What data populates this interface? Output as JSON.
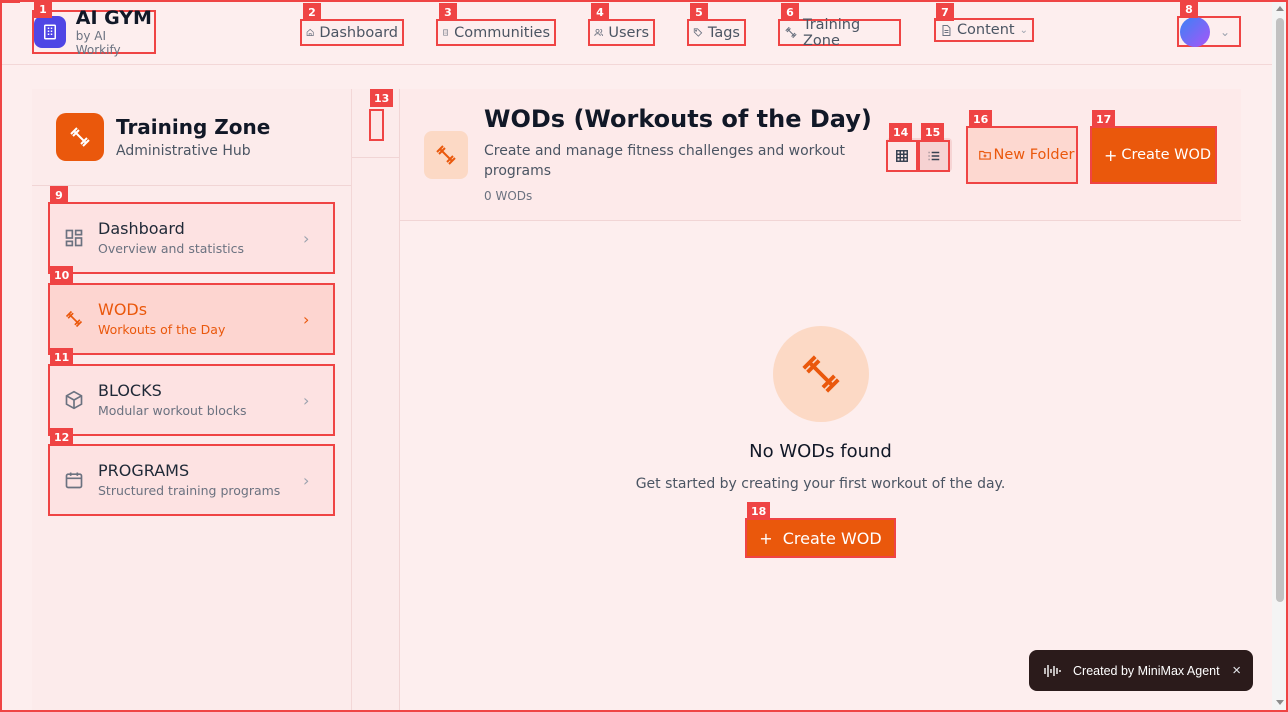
{
  "colors": {
    "accent": "#ea580c",
    "brand": "#4f46e5",
    "annotation": "#ef4444",
    "background": "#fdeeee"
  },
  "brand": {
    "title": "AI GYM",
    "subtitle": "by AI Workify",
    "icon": "building-icon"
  },
  "nav": {
    "items": [
      {
        "label": "Dashboard",
        "icon": "home-icon"
      },
      {
        "label": "Communities",
        "icon": "building-icon"
      },
      {
        "label": "Users",
        "icon": "users-icon"
      },
      {
        "label": "Tags",
        "icon": "tag-icon"
      },
      {
        "label": "Training Zone",
        "icon": "dumbbell-icon"
      },
      {
        "label": "Content",
        "icon": "document-icon"
      }
    ]
  },
  "badges": [
    "1",
    "2",
    "3",
    "4",
    "5",
    "6",
    "7",
    "8",
    "9",
    "10",
    "11",
    "12",
    "13",
    "14",
    "15",
    "16",
    "17",
    "18"
  ],
  "sidebar": {
    "title": "Training Zone",
    "subtitle": "Administrative Hub",
    "items": [
      {
        "label": "Dashboard",
        "desc": "Overview and statistics",
        "icon": "grid-icon"
      },
      {
        "label": "WODs",
        "desc": "Workouts of the Day",
        "icon": "dumbbell-icon"
      },
      {
        "label": "BLOCKS",
        "desc": "Modular workout blocks",
        "icon": "cube-icon"
      },
      {
        "label": "PROGRAMS",
        "desc": "Structured training programs",
        "icon": "calendar-icon"
      }
    ]
  },
  "header": {
    "title": "WODs (Workouts of the Day)",
    "description": "Create and manage fitness challenges and workout programs",
    "count": "0 WODs",
    "new_folder": "New Folder",
    "create_wod": "Create WOD"
  },
  "empty": {
    "title": "No WODs found",
    "description": "Get started by creating your first workout of the day.",
    "button": "Create WOD"
  },
  "toast": {
    "text": "Created by MiniMax Agent",
    "close": "×"
  }
}
